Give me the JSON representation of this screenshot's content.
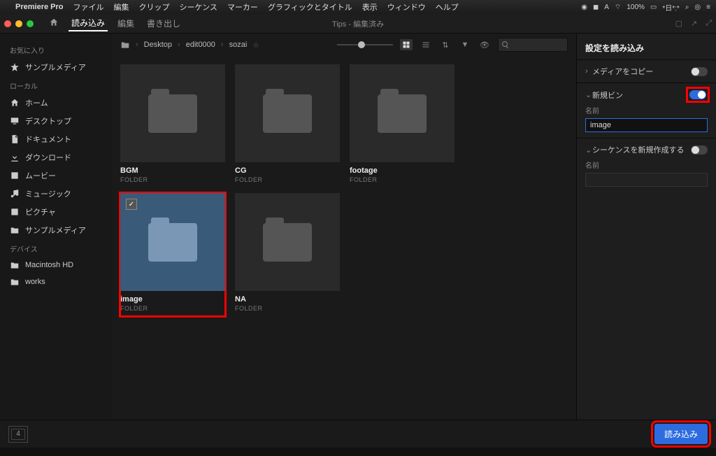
{
  "menubar": {
    "apple": "",
    "app": "Premiere Pro",
    "items": [
      "ファイル",
      "編集",
      "クリップ",
      "シーケンス",
      "マーカー",
      "グラフィックとタイトル",
      "表示",
      "ウィンドウ",
      "ヘルプ"
    ],
    "status": {
      "wifi": "100%",
      "time": "*日*:*"
    }
  },
  "toolbar": {
    "tabs": [
      {
        "icon": "home",
        "label": ""
      },
      {
        "label": "読み込み",
        "active": true
      },
      {
        "label": "編集"
      },
      {
        "label": "書き出し"
      }
    ],
    "title": "Tips - 編集済み"
  },
  "sidebar": {
    "sections": [
      {
        "header": "お気に入り",
        "items": [
          {
            "icon": "star",
            "label": "サンプルメディア"
          }
        ]
      },
      {
        "header": "ローカル",
        "items": [
          {
            "icon": "home",
            "label": "ホーム"
          },
          {
            "icon": "desktop",
            "label": "デスクトップ"
          },
          {
            "icon": "doc",
            "label": "ドキュメント"
          },
          {
            "icon": "download",
            "label": "ダウンロード"
          },
          {
            "icon": "movie",
            "label": "ムービー"
          },
          {
            "icon": "music",
            "label": "ミュージック"
          },
          {
            "icon": "picture",
            "label": "ピクチャ"
          },
          {
            "icon": "folder",
            "label": "サンプルメディア"
          }
        ]
      },
      {
        "header": "デバイス",
        "items": [
          {
            "icon": "folder",
            "label": "Macintosh HD"
          },
          {
            "icon": "folder",
            "label": "works"
          }
        ]
      }
    ]
  },
  "breadcrumb": {
    "items": [
      "Desktop",
      "edit0000",
      "sozai"
    ],
    "search_placeholder": ""
  },
  "folders": [
    {
      "name": "BGM",
      "type": "FOLDER",
      "selected": false
    },
    {
      "name": "CG",
      "type": "FOLDER",
      "selected": false
    },
    {
      "name": "footage",
      "type": "FOLDER",
      "selected": false
    },
    {
      "name": "image",
      "type": "FOLDER",
      "selected": true
    },
    {
      "name": "NA",
      "type": "FOLDER",
      "selected": false
    }
  ],
  "settings": {
    "title": "設定を読み込み",
    "copy_media": {
      "label": "メディアをコピー",
      "on": false
    },
    "new_bin": {
      "label": "新規ビン",
      "on": true,
      "name_label": "名前",
      "name_value": "image"
    },
    "new_seq": {
      "label": "シーケンスを新規作成する",
      "on": false,
      "name_label": "名前",
      "name_value": ""
    }
  },
  "footer": {
    "queue_count": "4",
    "import_label": "読み込み"
  }
}
